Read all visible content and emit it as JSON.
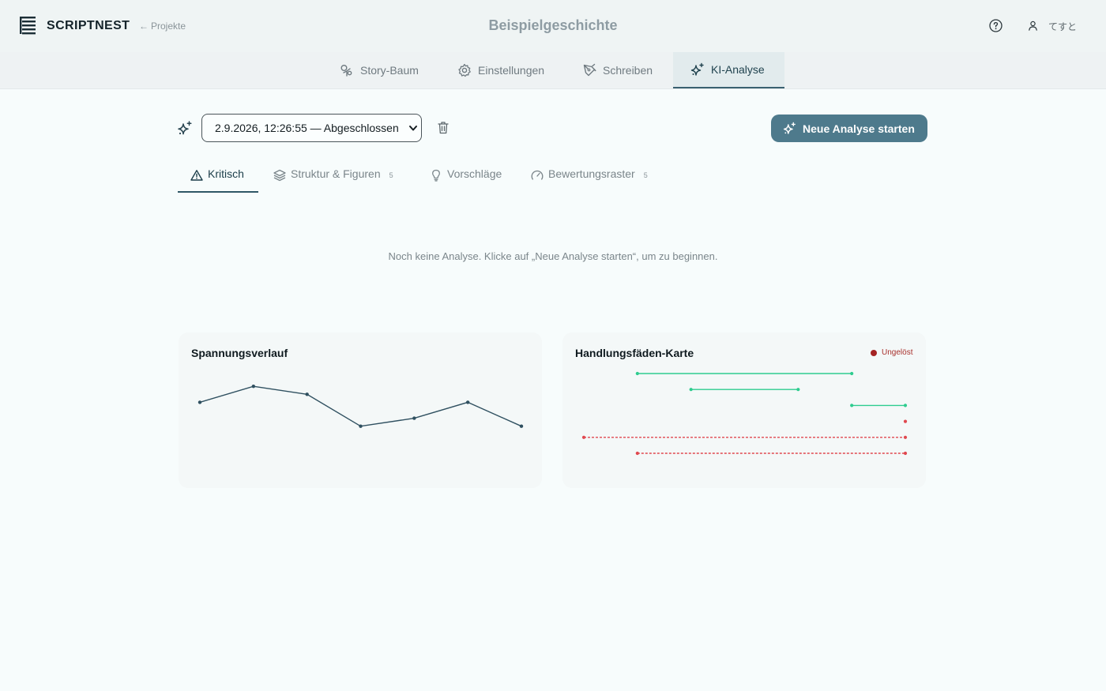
{
  "header": {
    "brand": "SCRIPTNEST",
    "back_link": "Projekte",
    "story_title": "Beispielgeschichte",
    "user_name": "てすと"
  },
  "main_tabs": [
    {
      "label": "Story-Baum",
      "icon": "tree-icon"
    },
    {
      "label": "Einstellungen",
      "icon": "gear-icon"
    },
    {
      "label": "Schreiben",
      "icon": "pen-icon"
    },
    {
      "label": "KI-Analyse",
      "icon": "sparkles-icon",
      "active": true
    }
  ],
  "toolbar": {
    "analysis_select_value": "2.9.2026, 12:26:55 — Abgeschlossen",
    "new_analysis_label": "Neue Analyse starten"
  },
  "sub_tabs": [
    {
      "label": "Kritisch",
      "icon": "warning-icon",
      "active": true
    },
    {
      "label": "Struktur & Figuren",
      "icon": "layers-icon",
      "count": "5"
    },
    {
      "label": "Vorschläge",
      "icon": "lightbulb-icon"
    },
    {
      "label": "Bewertungsraster",
      "icon": "gauge-icon",
      "count": "5"
    }
  ],
  "empty_message": "Noch keine Analyse. Klicke auf „Neue Analyse starten“, um zu beginnen.",
  "colors": {
    "accent": "#4e7a8c",
    "tension_line": "#2f5060",
    "resolved": "#2ecc8f",
    "unresolved": "#e0484f",
    "legend_dot": "#a42424"
  },
  "chart_data": [
    {
      "type": "line",
      "title": "Spannungsverlauf",
      "x": [
        1,
        2,
        3,
        4,
        5,
        6,
        7
      ],
      "values": [
        6,
        8,
        7,
        3,
        4,
        6,
        3
      ],
      "ylim": [
        0,
        10
      ],
      "grid": false,
      "axes_visible": false
    },
    {
      "type": "timeline",
      "title": "Handlungsfäden-Karte",
      "legend": [
        "Ungelöst"
      ],
      "x_range": [
        0,
        6
      ],
      "threads": [
        {
          "start": 1,
          "end": 5,
          "status": "resolved"
        },
        {
          "start": 2,
          "end": 4,
          "status": "resolved"
        },
        {
          "start": 5,
          "end": 6,
          "status": "resolved"
        },
        {
          "start": 6,
          "end": 6,
          "status": "unresolved"
        },
        {
          "start": 0,
          "end": 6,
          "status": "unresolved"
        },
        {
          "start": 1,
          "end": 6,
          "status": "unresolved"
        }
      ]
    }
  ]
}
